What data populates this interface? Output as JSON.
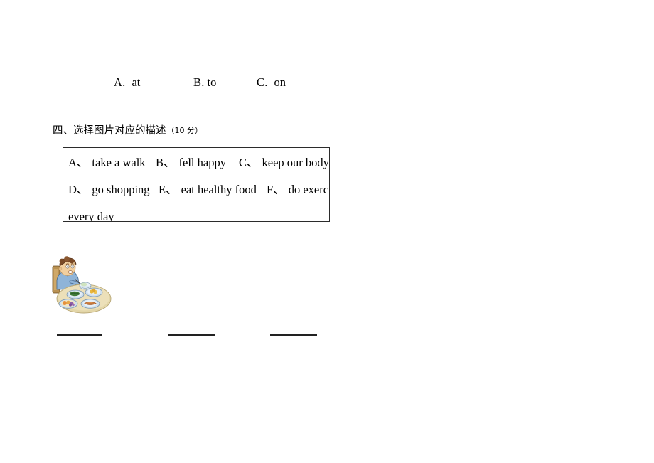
{
  "document": {
    "background_color": "#ffffff",
    "text_color": "#000000"
  },
  "multiple_choice_line": {
    "options": [
      {
        "label": "A.",
        "text": "at"
      },
      {
        "label": "B.",
        "text": "to"
      },
      {
        "label": "C.",
        "text": "on"
      }
    ]
  },
  "section": {
    "heading_title": "四、选择图片对应的描述",
    "heading_points": "（10 分）"
  },
  "word_bank": {
    "border_color": "#2b2b2b",
    "row1": [
      {
        "mark": "A、",
        "text": "take a walk"
      },
      {
        "mark": "B、",
        "text": "fell happy"
      },
      {
        "mark": "C、",
        "text": "keep our body c"
      }
    ],
    "row2": [
      {
        "mark": "D、",
        "text": "go shopping"
      },
      {
        "mark": "E、",
        "text": "eat healthy food"
      },
      {
        "mark": "F、",
        "text": "do exercise"
      }
    ],
    "row3_text": "every day"
  },
  "illustration": {
    "name": "boy-eating-meal-at-table",
    "description": "Clipart of a boy seated at a table with plates of food",
    "colors": {
      "hair": "#7a4a26",
      "skin": "#f2cf9e",
      "shirt": "#8fb4d8",
      "chair": "#b08b52",
      "table": "#e3d6a8",
      "plate": "#cfe0ef",
      "greens": "#3f7a38",
      "yellow_food": "#e8b63c",
      "fish": "#d98b4a",
      "grapes": "#8f5fa8",
      "orange": "#e5903c"
    }
  },
  "answer_blanks": [
    {
      "id": "blank-1"
    },
    {
      "id": "blank-2"
    },
    {
      "id": "blank-3"
    }
  ]
}
